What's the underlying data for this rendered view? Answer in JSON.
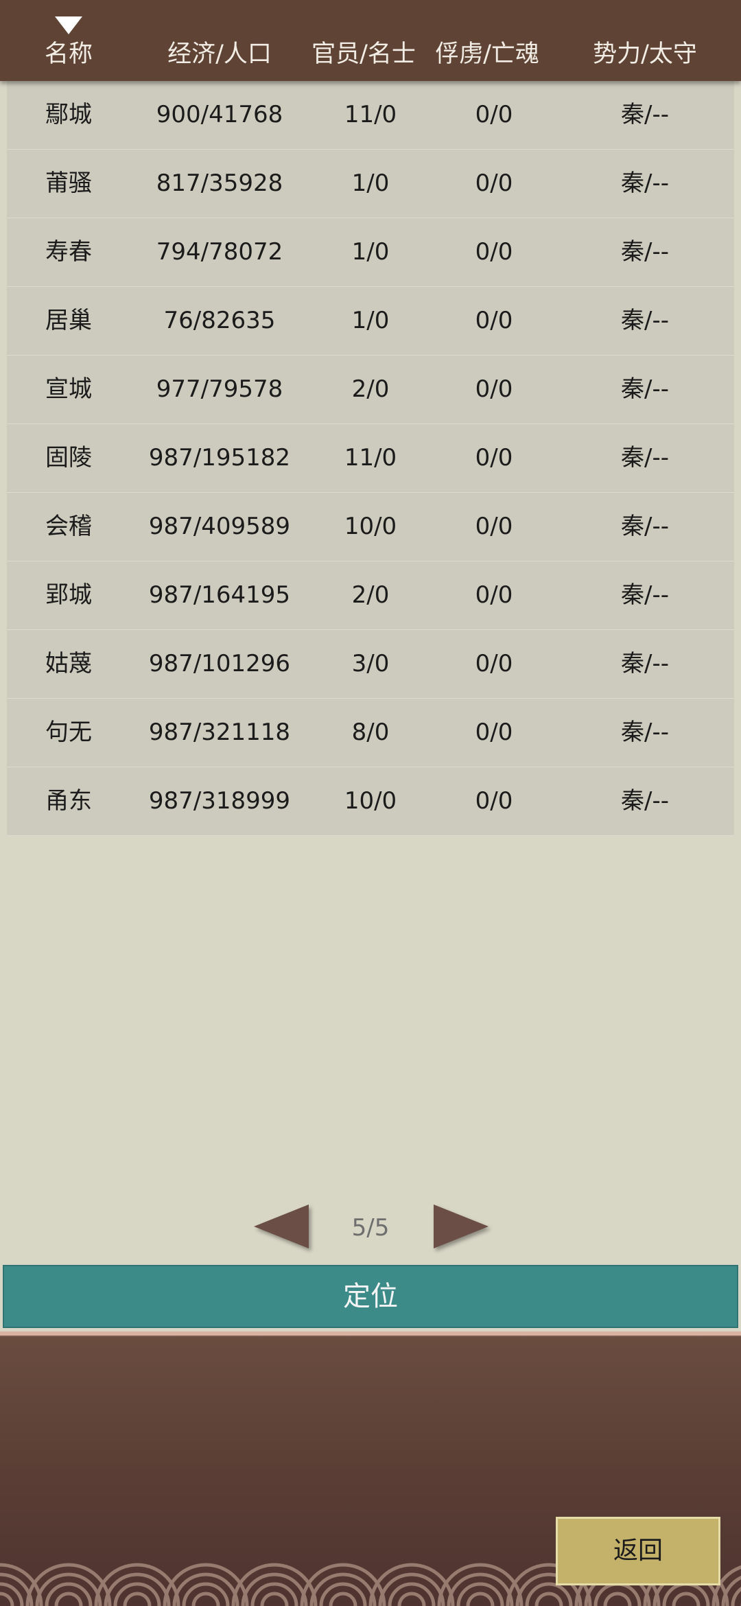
{
  "header": {
    "columns": [
      "名称",
      "经济/人口",
      "官员/名士",
      "俘虏/亡魂",
      "势力/太守"
    ]
  },
  "rows": [
    {
      "name": "鄢城",
      "economy_population": "900/41768",
      "officials_scholars": "11/0",
      "captives_souls": "0/0",
      "faction_governor": "秦/--"
    },
    {
      "name": "莆骚",
      "economy_population": "817/35928",
      "officials_scholars": "1/0",
      "captives_souls": "0/0",
      "faction_governor": "秦/--"
    },
    {
      "name": "寿春",
      "economy_population": "794/78072",
      "officials_scholars": "1/0",
      "captives_souls": "0/0",
      "faction_governor": "秦/--"
    },
    {
      "name": "居巢",
      "economy_population": "76/82635",
      "officials_scholars": "1/0",
      "captives_souls": "0/0",
      "faction_governor": "秦/--"
    },
    {
      "name": "宣城",
      "economy_population": "977/79578",
      "officials_scholars": "2/0",
      "captives_souls": "0/0",
      "faction_governor": "秦/--"
    },
    {
      "name": "固陵",
      "economy_population": "987/195182",
      "officials_scholars": "11/0",
      "captives_souls": "0/0",
      "faction_governor": "秦/--"
    },
    {
      "name": "会稽",
      "economy_population": "987/409589",
      "officials_scholars": "10/0",
      "captives_souls": "0/0",
      "faction_governor": "秦/--"
    },
    {
      "name": "郢城",
      "economy_population": "987/164195",
      "officials_scholars": "2/0",
      "captives_souls": "0/0",
      "faction_governor": "秦/--"
    },
    {
      "name": "姑蔑",
      "economy_population": "987/101296",
      "officials_scholars": "3/0",
      "captives_souls": "0/0",
      "faction_governor": "秦/--"
    },
    {
      "name": "句无",
      "economy_population": "987/321118",
      "officials_scholars": "8/0",
      "captives_souls": "0/0",
      "faction_governor": "秦/--"
    },
    {
      "name": "甬东",
      "economy_population": "987/318999",
      "officials_scholars": "10/0",
      "captives_souls": "0/0",
      "faction_governor": "秦/--"
    }
  ],
  "pager": {
    "indicator": "5/5"
  },
  "buttons": {
    "locate": "定位",
    "back": "返回"
  },
  "icons": {
    "sort": "sort-descending-triangle",
    "prev": "left-triangle-arrow",
    "next": "right-triangle-arrow"
  },
  "colors": {
    "header_bg": "#5f4436",
    "row_bg": "#cccbbd",
    "page_bg": "#d8d6c5",
    "locate_bg": "#3d8b89",
    "back_bg": "#c4b26b",
    "arrow": "#6b4e45"
  }
}
